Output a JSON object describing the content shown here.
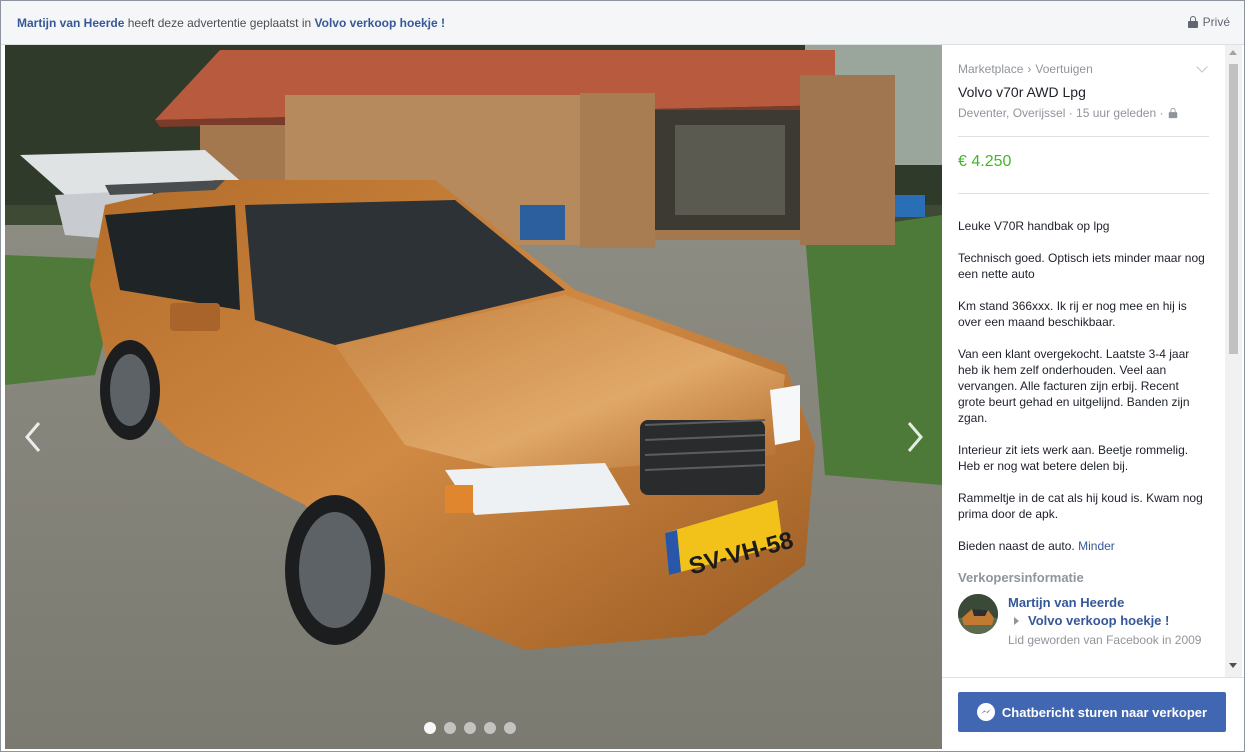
{
  "header": {
    "poster_name": "Martijn van Heerde",
    "posted_text": "heeft deze advertentie geplaatst in",
    "group_name": "Volvo verkoop hoekje !",
    "privacy_label": "Privé"
  },
  "photo": {
    "plate": "SV-VH-58",
    "dot_count": 5,
    "active_dot": 1
  },
  "listing": {
    "breadcrumb": [
      "Marketplace",
      "Voertuigen"
    ],
    "breadcrumb_separator": "›",
    "title": "Volvo v70r AWD Lpg",
    "location": "Deventer, Overijssel",
    "time_ago": "15 uur geleden",
    "price": "€ 4.250",
    "description": [
      "Leuke V70R handbak op lpg",
      "Technisch goed. Optisch iets minder maar nog een nette auto",
      "Km stand 366xxx. Ik rij er nog mee en hij is over een maand beschikbaar.",
      "Van een klant overgekocht. Laatste 3-4 jaar heb ik hem zelf onderhouden. Veel aan vervangen. Alle facturen zijn erbij. Recent grote beurt gehad en uitgelijnd. Banden zijn zgan.",
      "Interieur zit iets werk aan. Beetje rommelig. Heb er nog wat betere delen bij.",
      "Rammeltje in de cat als hij koud is. Kwam nog prima door de apk."
    ],
    "last_line": "Bieden naast de auto.",
    "less_link": "Minder"
  },
  "seller": {
    "heading": "Verkopersinformatie",
    "name": "Martijn van Heerde",
    "group": "Volvo verkoop hoekje !",
    "joined": "Lid geworden van Facebook in 2009"
  },
  "footer": {
    "cta_label": "Chatbericht sturen naar verkoper"
  },
  "colors": {
    "link": "#365899",
    "price": "#42b72a",
    "button": "#4267b2",
    "car": "#c07a32"
  },
  "icons": {
    "privacy": "lock-icon",
    "prev": "chevron-left-icon",
    "next": "chevron-right-icon",
    "messenger": "messenger-icon",
    "dropdown": "chevron-down-icon"
  }
}
